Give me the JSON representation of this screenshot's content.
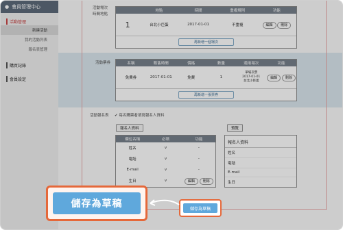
{
  "sidebar": {
    "title": "會員管理中心",
    "sections": [
      {
        "label": "活動管理",
        "items": [
          "新建活動",
          "我的活動列表",
          "報名表管理"
        ]
      },
      {
        "label": "購買記錄",
        "items": []
      },
      {
        "label": "會員設定",
        "items": []
      }
    ]
  },
  "session": {
    "label_line1": "活動場次",
    "label_line2": "時間地點",
    "headers": [
      "地點",
      "時間",
      "重複規則",
      "功能"
    ],
    "row": {
      "index": "1",
      "place": "台北小巨蛋",
      "date": "2017-01-01",
      "repeat": "不重複",
      "edit": "編輯",
      "delete": "刪除"
    },
    "add_button": "再新增一個場次"
  },
  "ticket": {
    "label": "活動票券",
    "headers": [
      "名稱",
      "販售時間",
      "價格",
      "數量",
      "適用場次",
      "功能"
    ],
    "row": {
      "name": "免費券",
      "date": "2017-01-01",
      "price": "免費",
      "qty": "1",
      "applies1": "單場次票",
      "applies2": "2017-01-01",
      "applies3": "台北小巨蛋",
      "edit": "編輯",
      "delete": "刪除"
    },
    "add_button": "再新增一張票券"
  },
  "signup": {
    "label": "活動報名表",
    "checkbox_text": "每名購票者填寫報名人資料",
    "tag_left": "報名人資料",
    "tag_right": "預覽",
    "headers": [
      "欄位名稱",
      "必填",
      "功能"
    ],
    "rows": [
      {
        "field": "姓名",
        "req": "v",
        "fn": "-"
      },
      {
        "field": "電話",
        "req": "v",
        "fn": "-"
      },
      {
        "field": "E-mail",
        "req": "v",
        "fn": "-"
      },
      {
        "field": "生日",
        "req": "v",
        "edit": "編輯",
        "delete": "刪除"
      }
    ],
    "preview_title": "報名人資料",
    "preview_rows": [
      "姓名",
      "電話",
      "E-mail",
      "生日"
    ]
  },
  "save": {
    "big_label": "儲存為草稿",
    "small_label": "儲存為草稿"
  },
  "colors": {
    "accent": "#5fa8dc",
    "highlight": "#e5683a",
    "header": "#77808c"
  }
}
